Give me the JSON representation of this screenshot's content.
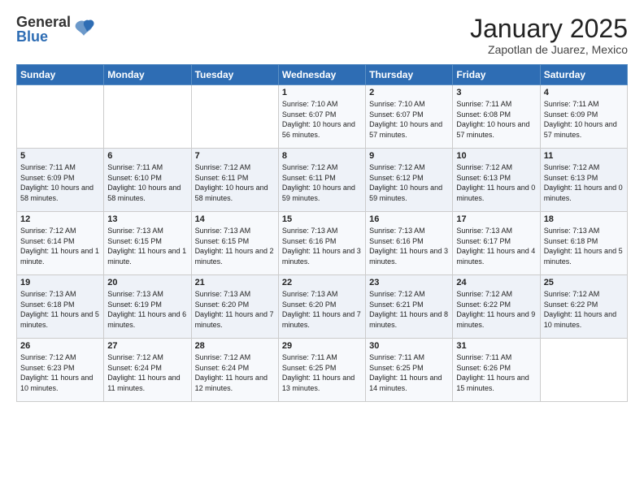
{
  "logo": {
    "general": "General",
    "blue": "Blue"
  },
  "title": "January 2025",
  "subtitle": "Zapotlan de Juarez, Mexico",
  "days_header": [
    "Sunday",
    "Monday",
    "Tuesday",
    "Wednesday",
    "Thursday",
    "Friday",
    "Saturday"
  ],
  "weeks": [
    [
      {
        "day": "",
        "info": ""
      },
      {
        "day": "",
        "info": ""
      },
      {
        "day": "",
        "info": ""
      },
      {
        "day": "1",
        "info": "Sunrise: 7:10 AM\nSunset: 6:07 PM\nDaylight: 10 hours and 56 minutes."
      },
      {
        "day": "2",
        "info": "Sunrise: 7:10 AM\nSunset: 6:07 PM\nDaylight: 10 hours and 57 minutes."
      },
      {
        "day": "3",
        "info": "Sunrise: 7:11 AM\nSunset: 6:08 PM\nDaylight: 10 hours and 57 minutes."
      },
      {
        "day": "4",
        "info": "Sunrise: 7:11 AM\nSunset: 6:09 PM\nDaylight: 10 hours and 57 minutes."
      }
    ],
    [
      {
        "day": "5",
        "info": "Sunrise: 7:11 AM\nSunset: 6:09 PM\nDaylight: 10 hours and 58 minutes."
      },
      {
        "day": "6",
        "info": "Sunrise: 7:11 AM\nSunset: 6:10 PM\nDaylight: 10 hours and 58 minutes."
      },
      {
        "day": "7",
        "info": "Sunrise: 7:12 AM\nSunset: 6:11 PM\nDaylight: 10 hours and 58 minutes."
      },
      {
        "day": "8",
        "info": "Sunrise: 7:12 AM\nSunset: 6:11 PM\nDaylight: 10 hours and 59 minutes."
      },
      {
        "day": "9",
        "info": "Sunrise: 7:12 AM\nSunset: 6:12 PM\nDaylight: 10 hours and 59 minutes."
      },
      {
        "day": "10",
        "info": "Sunrise: 7:12 AM\nSunset: 6:13 PM\nDaylight: 11 hours and 0 minutes."
      },
      {
        "day": "11",
        "info": "Sunrise: 7:12 AM\nSunset: 6:13 PM\nDaylight: 11 hours and 0 minutes."
      }
    ],
    [
      {
        "day": "12",
        "info": "Sunrise: 7:12 AM\nSunset: 6:14 PM\nDaylight: 11 hours and 1 minute."
      },
      {
        "day": "13",
        "info": "Sunrise: 7:13 AM\nSunset: 6:15 PM\nDaylight: 11 hours and 1 minute."
      },
      {
        "day": "14",
        "info": "Sunrise: 7:13 AM\nSunset: 6:15 PM\nDaylight: 11 hours and 2 minutes."
      },
      {
        "day": "15",
        "info": "Sunrise: 7:13 AM\nSunset: 6:16 PM\nDaylight: 11 hours and 3 minutes."
      },
      {
        "day": "16",
        "info": "Sunrise: 7:13 AM\nSunset: 6:16 PM\nDaylight: 11 hours and 3 minutes."
      },
      {
        "day": "17",
        "info": "Sunrise: 7:13 AM\nSunset: 6:17 PM\nDaylight: 11 hours and 4 minutes."
      },
      {
        "day": "18",
        "info": "Sunrise: 7:13 AM\nSunset: 6:18 PM\nDaylight: 11 hours and 5 minutes."
      }
    ],
    [
      {
        "day": "19",
        "info": "Sunrise: 7:13 AM\nSunset: 6:18 PM\nDaylight: 11 hours and 5 minutes."
      },
      {
        "day": "20",
        "info": "Sunrise: 7:13 AM\nSunset: 6:19 PM\nDaylight: 11 hours and 6 minutes."
      },
      {
        "day": "21",
        "info": "Sunrise: 7:13 AM\nSunset: 6:20 PM\nDaylight: 11 hours and 7 minutes."
      },
      {
        "day": "22",
        "info": "Sunrise: 7:13 AM\nSunset: 6:20 PM\nDaylight: 11 hours and 7 minutes."
      },
      {
        "day": "23",
        "info": "Sunrise: 7:12 AM\nSunset: 6:21 PM\nDaylight: 11 hours and 8 minutes."
      },
      {
        "day": "24",
        "info": "Sunrise: 7:12 AM\nSunset: 6:22 PM\nDaylight: 11 hours and 9 minutes."
      },
      {
        "day": "25",
        "info": "Sunrise: 7:12 AM\nSunset: 6:22 PM\nDaylight: 11 hours and 10 minutes."
      }
    ],
    [
      {
        "day": "26",
        "info": "Sunrise: 7:12 AM\nSunset: 6:23 PM\nDaylight: 11 hours and 10 minutes."
      },
      {
        "day": "27",
        "info": "Sunrise: 7:12 AM\nSunset: 6:24 PM\nDaylight: 11 hours and 11 minutes."
      },
      {
        "day": "28",
        "info": "Sunrise: 7:12 AM\nSunset: 6:24 PM\nDaylight: 11 hours and 12 minutes."
      },
      {
        "day": "29",
        "info": "Sunrise: 7:11 AM\nSunset: 6:25 PM\nDaylight: 11 hours and 13 minutes."
      },
      {
        "day": "30",
        "info": "Sunrise: 7:11 AM\nSunset: 6:25 PM\nDaylight: 11 hours and 14 minutes."
      },
      {
        "day": "31",
        "info": "Sunrise: 7:11 AM\nSunset: 6:26 PM\nDaylight: 11 hours and 15 minutes."
      },
      {
        "day": "",
        "info": ""
      }
    ]
  ]
}
